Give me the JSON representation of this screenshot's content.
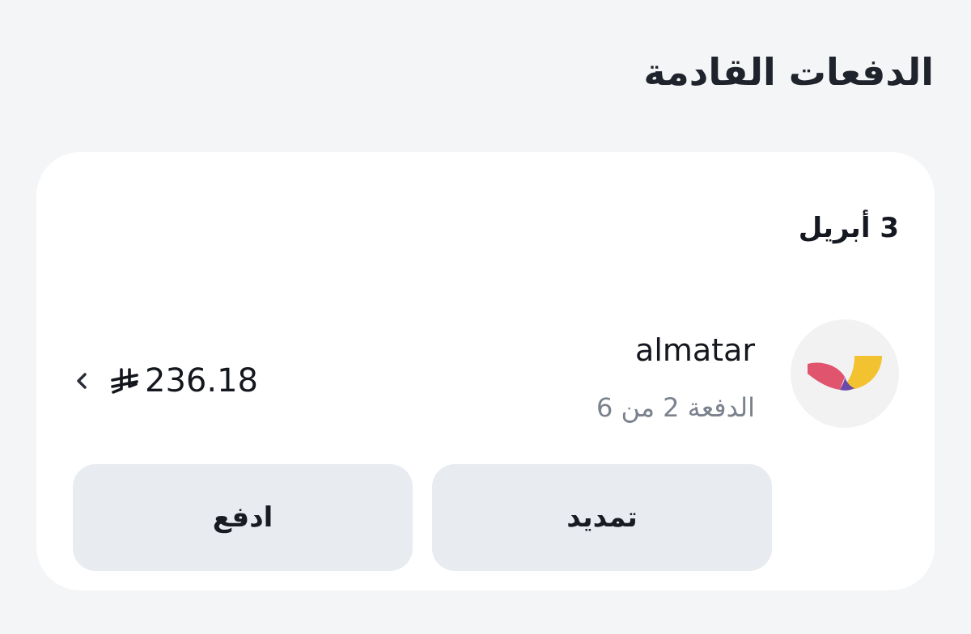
{
  "section": {
    "title": "الدفعات القادمة"
  },
  "payment": {
    "date": "3 أبريل",
    "merchant": {
      "name": "almatar",
      "logo_icon": "almatar-logo-icon"
    },
    "installment_text": "الدفعة 2 من 6",
    "amount": "236.18",
    "currency_icon": "saudi-riyal-icon",
    "details_icon": "chevron-left-icon"
  },
  "actions": {
    "extend_label": "تمديد",
    "pay_label": "ادفع"
  },
  "colors": {
    "background": "#f4f5f7",
    "card": "#ffffff",
    "button": "#e8ecf0",
    "muted_text": "#7b828d",
    "logo_red": "#e0546e",
    "logo_yellow": "#f2c230",
    "logo_purple": "#6a4aa8"
  }
}
